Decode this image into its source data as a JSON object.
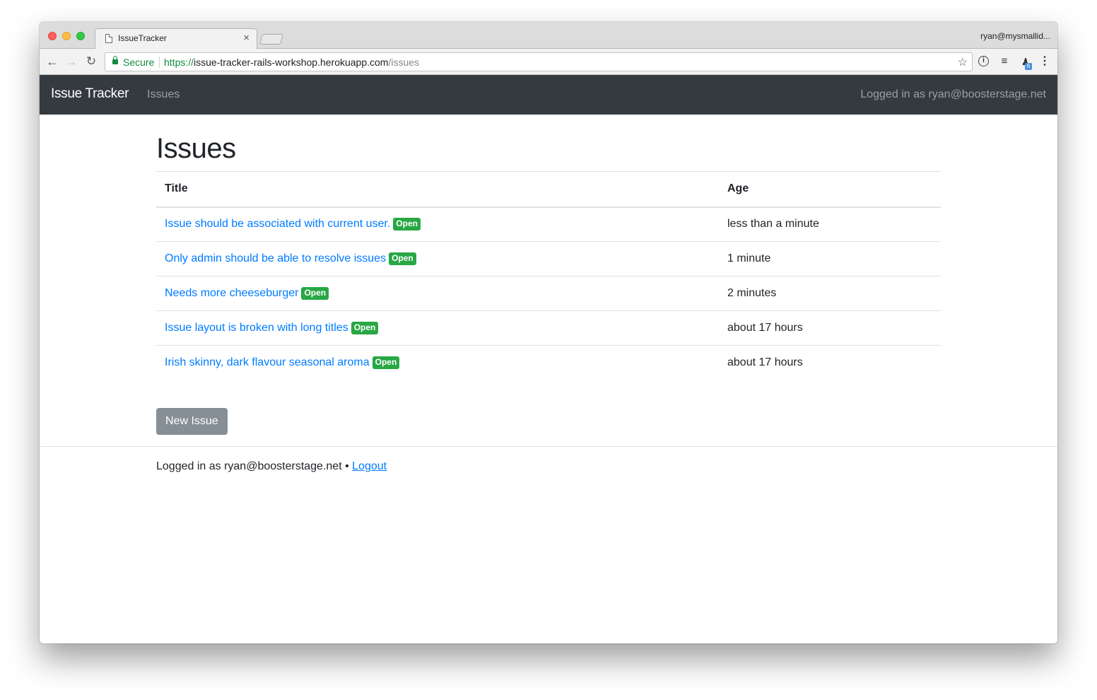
{
  "browser": {
    "tab_title": "IssueTracker",
    "tab_close": "×",
    "profile": "ryan@mysmallid...",
    "secure_label": "Secure",
    "url_scheme": "https://",
    "url_host": "issue-tracker-rails-workshop.herokuapp.com",
    "url_path": "/issues",
    "back_glyph": "←",
    "forward_glyph": "→",
    "reload_glyph": "↻",
    "star_glyph": "☆",
    "ext_badge": "6"
  },
  "navbar": {
    "brand": "Issue Tracker",
    "link": "Issues",
    "user": "Logged in as ryan@boosterstage.net"
  },
  "page": {
    "title": "Issues",
    "columns": {
      "title": "Title",
      "age": "Age"
    },
    "issues": [
      {
        "title": "Issue should be associated with current user.",
        "status": "Open",
        "age": "less than a minute"
      },
      {
        "title": "Only admin should be able to resolve issues",
        "status": "Open",
        "age": "1 minute"
      },
      {
        "title": "Needs more cheeseburger",
        "status": "Open",
        "age": "2 minutes"
      },
      {
        "title": "Issue layout is broken with long titles",
        "status": "Open",
        "age": "about 17 hours"
      },
      {
        "title": "Irish skinny, dark flavour seasonal aroma",
        "status": "Open",
        "age": "about 17 hours"
      }
    ],
    "new_button": "New Issue"
  },
  "footer": {
    "text": "Logged in as ryan@boosterstage.net •",
    "logout": "Logout"
  },
  "colors": {
    "navbar_bg": "#343a40",
    "link": "#007bff",
    "badge_open": "#28a745",
    "button_secondary": "#868e96"
  }
}
